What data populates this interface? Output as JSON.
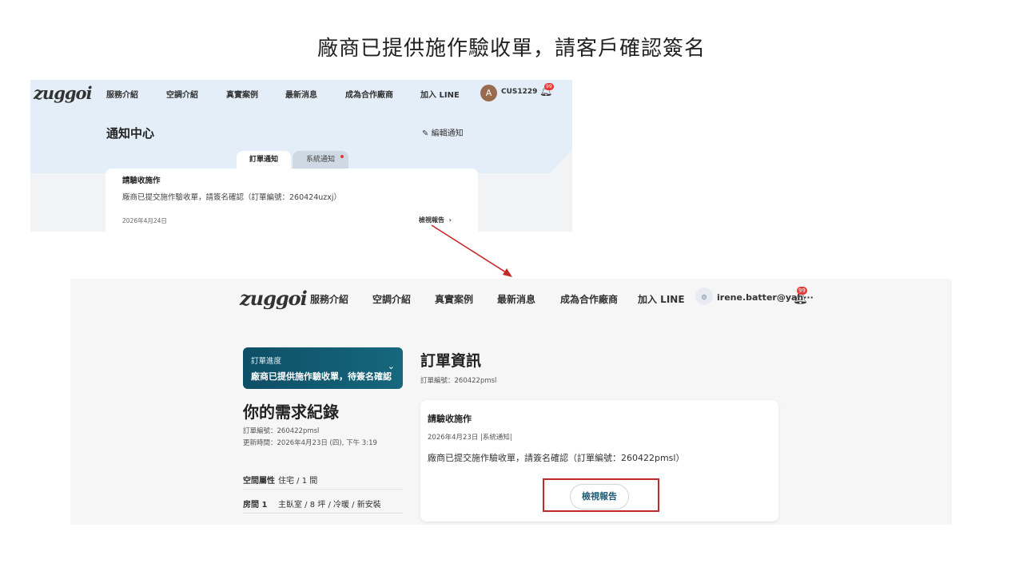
{
  "slide": {
    "title": "廠商已提供施作驗收單，請客戶確認簽名"
  },
  "shot1": {
    "logo": "zuggoi",
    "nav": [
      "服務介紹",
      "空調介紹",
      "真實案例",
      "最新消息",
      "成為合作廠商",
      "加入 LINE"
    ],
    "avatar_initial": "A",
    "username": "CUS1229",
    "notification_badge": "99",
    "page_title": "通知中心",
    "edit_link": "編輯通知",
    "tabs": [
      "訂單通知",
      "系統通知"
    ],
    "card": {
      "title": "請驗收施作",
      "body": "廠商已提交施作驗收單，請簽名確認（訂單編號：260424uzxj）",
      "date": "2026年4月24日",
      "link": "檢視報告"
    }
  },
  "shot2": {
    "logo": "zuggoi",
    "nav": [
      "服務介紹",
      "空調介紹",
      "真實案例",
      "最新消息",
      "成為合作廠商",
      "加入 LINE"
    ],
    "username": "irene.batter@yah···",
    "notification_badge": "99",
    "progress": {
      "label": "訂單進度",
      "value": "廠商已提供施作驗收單，待簽名確認"
    },
    "requirement": {
      "title": "你的需求紀錄",
      "order_no": "訂單編號：260422pmsl",
      "updated": "更新時間：2026年4月23日 (四), 下午 3:19",
      "specs": [
        {
          "key": "空間屬性",
          "value": "住宅 / 1 間"
        },
        {
          "key": "房間 1",
          "value": "主臥室 / 8 坪 / 冷暖 / 新安裝"
        }
      ]
    },
    "order": {
      "title": "訂單資訊",
      "order_no": "訂單編號：260422pmsl",
      "card": {
        "title": "請驗收施作",
        "date": "2026年4月23日 |系統通知|",
        "body": "廠商已提交施作驗收單，請簽名確認（訂單編號：260422pmsl）",
        "button": "檢視報告"
      }
    }
  },
  "colors": {
    "annotation_red": "#c62828",
    "progress_teal": "#0d4f66",
    "header_blue": "#e3eef8"
  }
}
